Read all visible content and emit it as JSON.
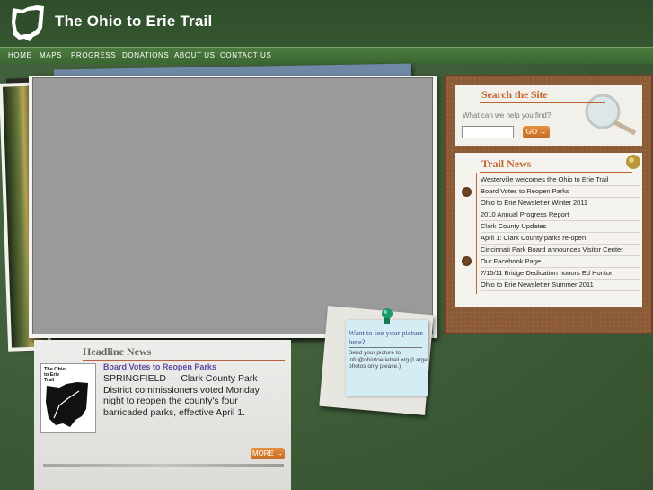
{
  "header": {
    "title": "The Ohio to Erie Trail"
  },
  "nav": {
    "items": [
      "HOME",
      "MAPS",
      "PROGRESS",
      "DONATIONS",
      "ABOUT US",
      "CONTACT US"
    ]
  },
  "search": {
    "title": "Search the Site",
    "prompt": "What can we help you find?",
    "input_value": "",
    "go_label": "GO"
  },
  "trail_news": {
    "title": "Trail News",
    "items": [
      "Westerville welcomes the Ohio to Erie Trail",
      "Board Votes to Reopen Parks",
      "Ohio to Erie Newsletter Winter 2011",
      "2010 Annual Progress Report",
      "Clark County Updates",
      "April 1: Clark County parks re-open",
      "Cincinnati Park Board announces Visitor Center",
      "Our Facebook Page",
      "7/15/11 Bridge Dedication honors Ed Honton",
      "Ohio to Erie Newsletter Summer 2011"
    ]
  },
  "headline": {
    "title": "Headline News",
    "link": "Board Votes to Reopen Parks",
    "body": "SPRINGFIELD — Clark County Park District commissioners voted Monday night to reopen the county's four barricaded parks, effective April 1.",
    "more_label": "MORE",
    "thumb_text": "The Ohio to Erie Trail"
  },
  "note": {
    "heading": "Want to see your picture here?",
    "body": "Send your picture to info@ohiotoerietrail.org (Large photos only please.)"
  },
  "colors": {
    "accent": "#c0642e",
    "nav": "#3f6d36",
    "header": "#2f4d2c"
  }
}
